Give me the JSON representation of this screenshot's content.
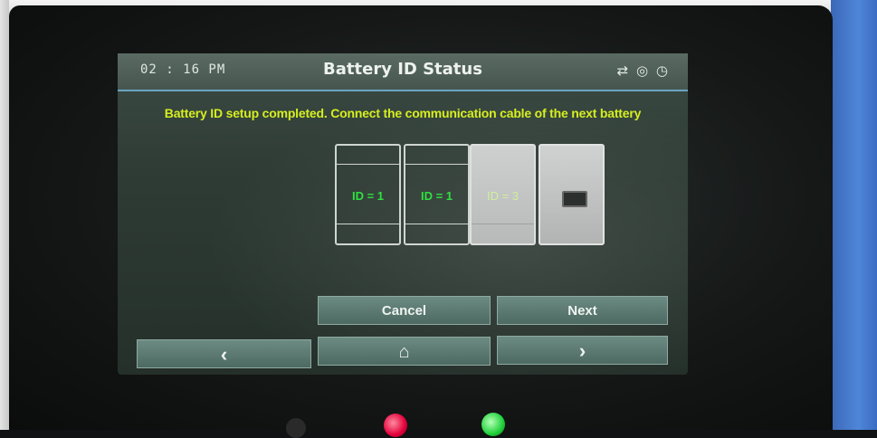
{
  "header": {
    "time": "02 : 16 PM",
    "title": "Battery ID Status",
    "icons": [
      "refresh-icon",
      "globe-icon",
      "clock-icon"
    ]
  },
  "message": "Battery ID setup completed. Connect the communication cable of the next battery",
  "batteries": [
    {
      "label": "ID = 1",
      "state": "configured"
    },
    {
      "label": "ID = 1",
      "state": "configured"
    },
    {
      "label": "ID = 3",
      "state": "faded"
    },
    {
      "label": "",
      "state": "not-connected"
    }
  ],
  "buttons": {
    "cancel": "Cancel",
    "next": "Next",
    "prev_glyph": "‹",
    "home_glyph": "⌂",
    "forward_glyph": "›"
  },
  "colors": {
    "message": "#d6ee20",
    "id_label": "#2ee040",
    "title_underline": "#6aa4c2"
  }
}
